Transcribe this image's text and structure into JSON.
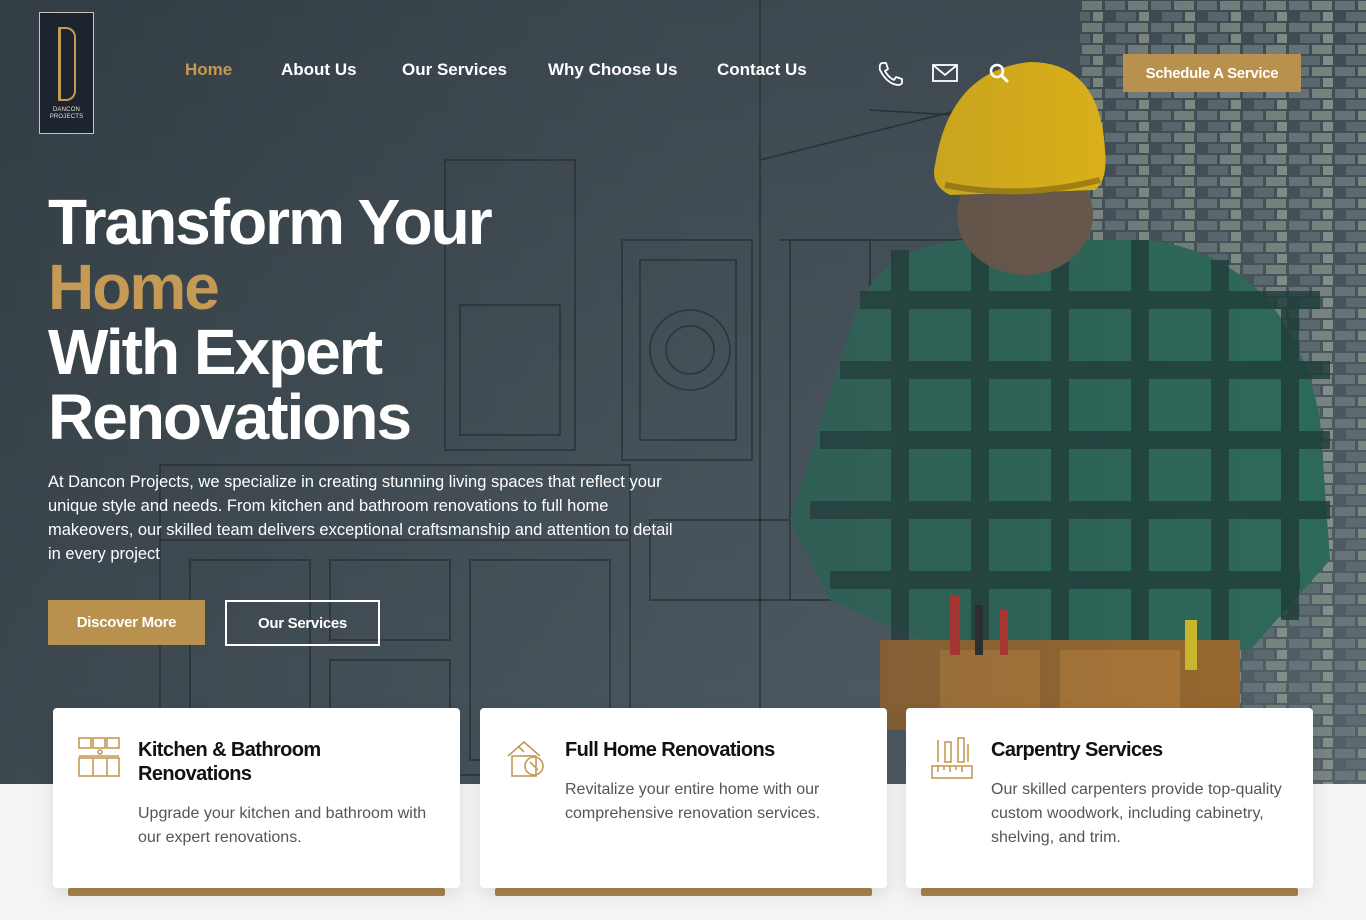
{
  "logo": {
    "line1": "DANCON",
    "line2": "PROJECTS"
  },
  "nav": {
    "items": [
      {
        "label": "Home",
        "active": true
      },
      {
        "label": "About Us"
      },
      {
        "label": "Our Services"
      },
      {
        "label": "Why Choose Us"
      },
      {
        "label": "Contact Us"
      }
    ]
  },
  "header_icons": [
    "phone-icon",
    "mail-icon",
    "search-icon"
  ],
  "schedule_label": "Schedule A Service",
  "hero": {
    "line1": "Transform Your",
    "line2": "Home",
    "line3": "With Expert",
    "line4": "Renovations",
    "intro": "At Dancon Projects, we specialize in creating stunning living spaces that reflect your unique style and needs. From kitchen and bathroom renovations to full home makeovers, our skilled team delivers exceptional craftsmanship and attention to detail in every project",
    "discover_label": "Discover More",
    "services_label": "Our Services"
  },
  "cards": [
    {
      "title": "Kitchen & Bathroom Renovations",
      "desc": "Upgrade your kitchen and bathroom with our expert renovations.",
      "icon": "kitchen-icon"
    },
    {
      "title": "Full Home Renovations",
      "desc": "Revitalize your entire home with our comprehensive renovation services.",
      "icon": "home-renovation-icon"
    },
    {
      "title": "Carpentry Services",
      "desc": "Our skilled carpenters provide top-quality custom woodwork, including cabinetry, shelving, and trim.",
      "icon": "carpentry-tools-icon"
    }
  ],
  "colors": {
    "accent": "#c49a55",
    "button": "#b8914f",
    "card_bar": "#a8844a"
  }
}
